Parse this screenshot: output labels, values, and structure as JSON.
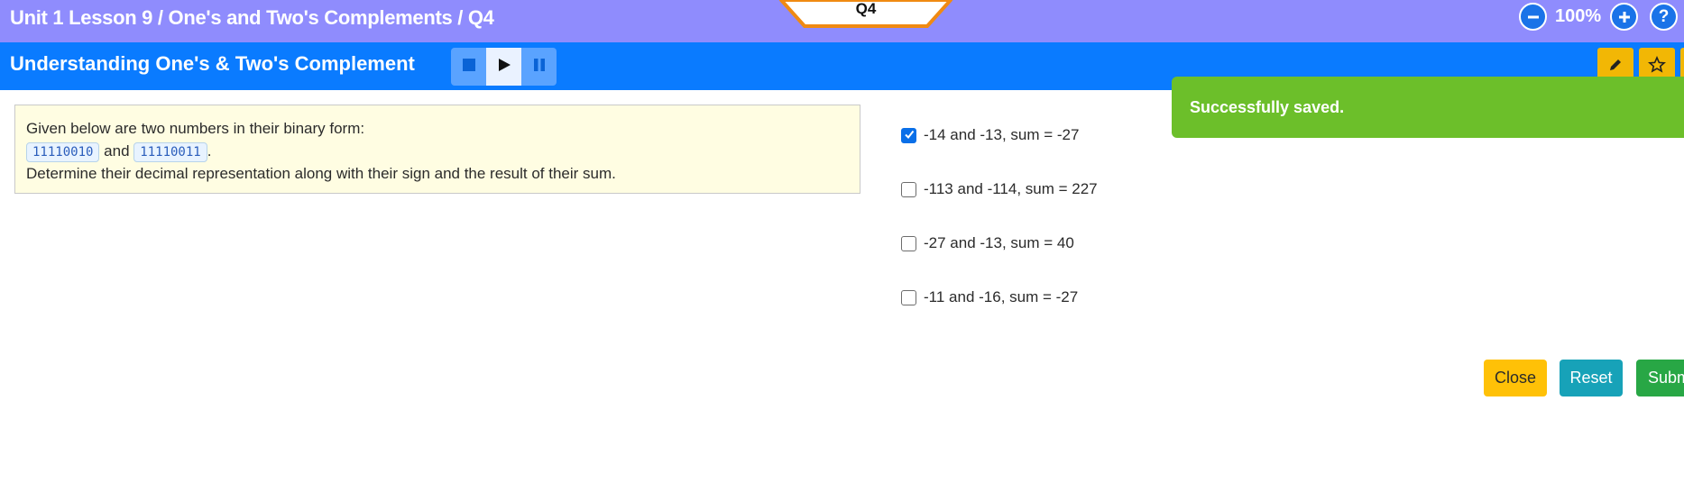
{
  "breadcrumb": "Unit 1 Lesson 9 / One's and Two's Complements / Q4",
  "question_tab": "Q4",
  "zoom": {
    "level": "100%",
    "minus_icon": "minus-circle-icon",
    "plus_icon": "plus-circle-icon",
    "help_icon": "question-circle-icon",
    "help_label": "?"
  },
  "title": "Understanding One's & Two's Complement",
  "media": {
    "stop_icon": "stop-icon",
    "play_icon": "play-icon",
    "pause_icon": "pause-icon"
  },
  "tools": {
    "edit_icon": "pencil-icon",
    "star_icon": "star-icon"
  },
  "question": {
    "line1": "Given below are two numbers in their binary form:",
    "binary1": "11110010",
    "connector": "and",
    "binary2": "11110011",
    "period": ".",
    "line3": "Determine their decimal representation along with their sign and the result of their sum."
  },
  "options": [
    {
      "label": "-14 and -13, sum = -27",
      "checked": true
    },
    {
      "label": "-113 and -114, sum = 227",
      "checked": false
    },
    {
      "label": "-27 and -13, sum = 40",
      "checked": false
    },
    {
      "label": "-11 and -16, sum = -27",
      "checked": false
    }
  ],
  "toast": {
    "message": "Successfully saved."
  },
  "buttons": {
    "close": "Close",
    "reset": "Reset",
    "submit": "Submit"
  },
  "colors": {
    "topbar": "#8f8cfd",
    "titlebar": "#0a7bff",
    "tab_border": "#f08a12",
    "close": "#ffc107",
    "reset": "#17a2b8",
    "submit": "#28a745",
    "toast": "#6cbf2a"
  }
}
